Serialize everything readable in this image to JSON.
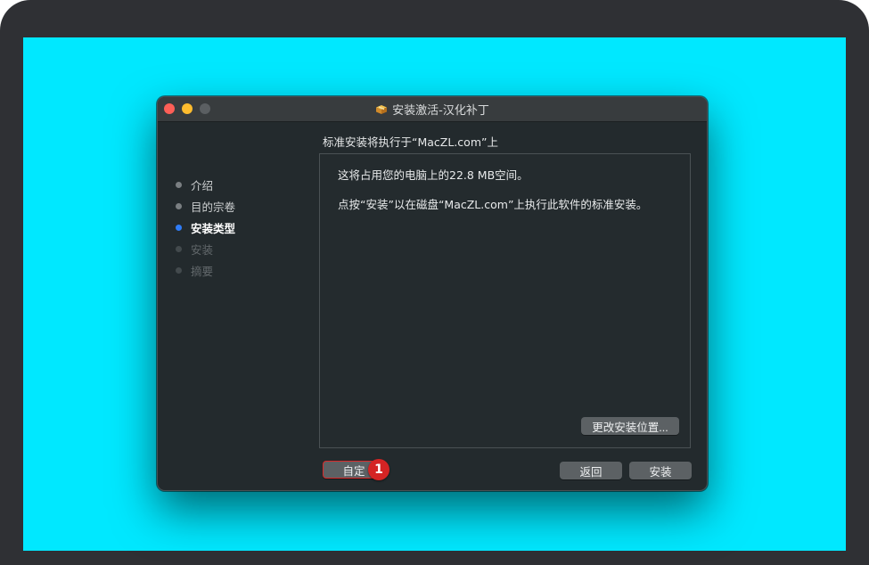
{
  "window": {
    "title": "安装激活-汉化补丁",
    "title_icon": "package-icon",
    "subtitle": "标准安装将执行于“MacZL.com”上"
  },
  "sidebar": {
    "steps": [
      {
        "label": "介绍",
        "state": "done"
      },
      {
        "label": "目的宗卷",
        "state": "done"
      },
      {
        "label": "安装类型",
        "state": "active"
      },
      {
        "label": "安装",
        "state": "pending"
      },
      {
        "label": "摘要",
        "state": "pending"
      }
    ]
  },
  "content": {
    "line1": "这将占用您的电脑上的22.8 MB空间。",
    "line2": "点按“安装”以在磁盘“MacZL.com”上执行此软件的标准安装。",
    "change_location_label": "更改安装位置..."
  },
  "footer": {
    "customize_label": "自定",
    "back_label": "返回",
    "install_label": "安装"
  },
  "annotation": {
    "badge": "1"
  },
  "colors": {
    "screen_background": "#00e8ff",
    "window_background": "#232a2d",
    "active_step_dot": "#2f7cf6",
    "annotation_red": "#d42424"
  }
}
